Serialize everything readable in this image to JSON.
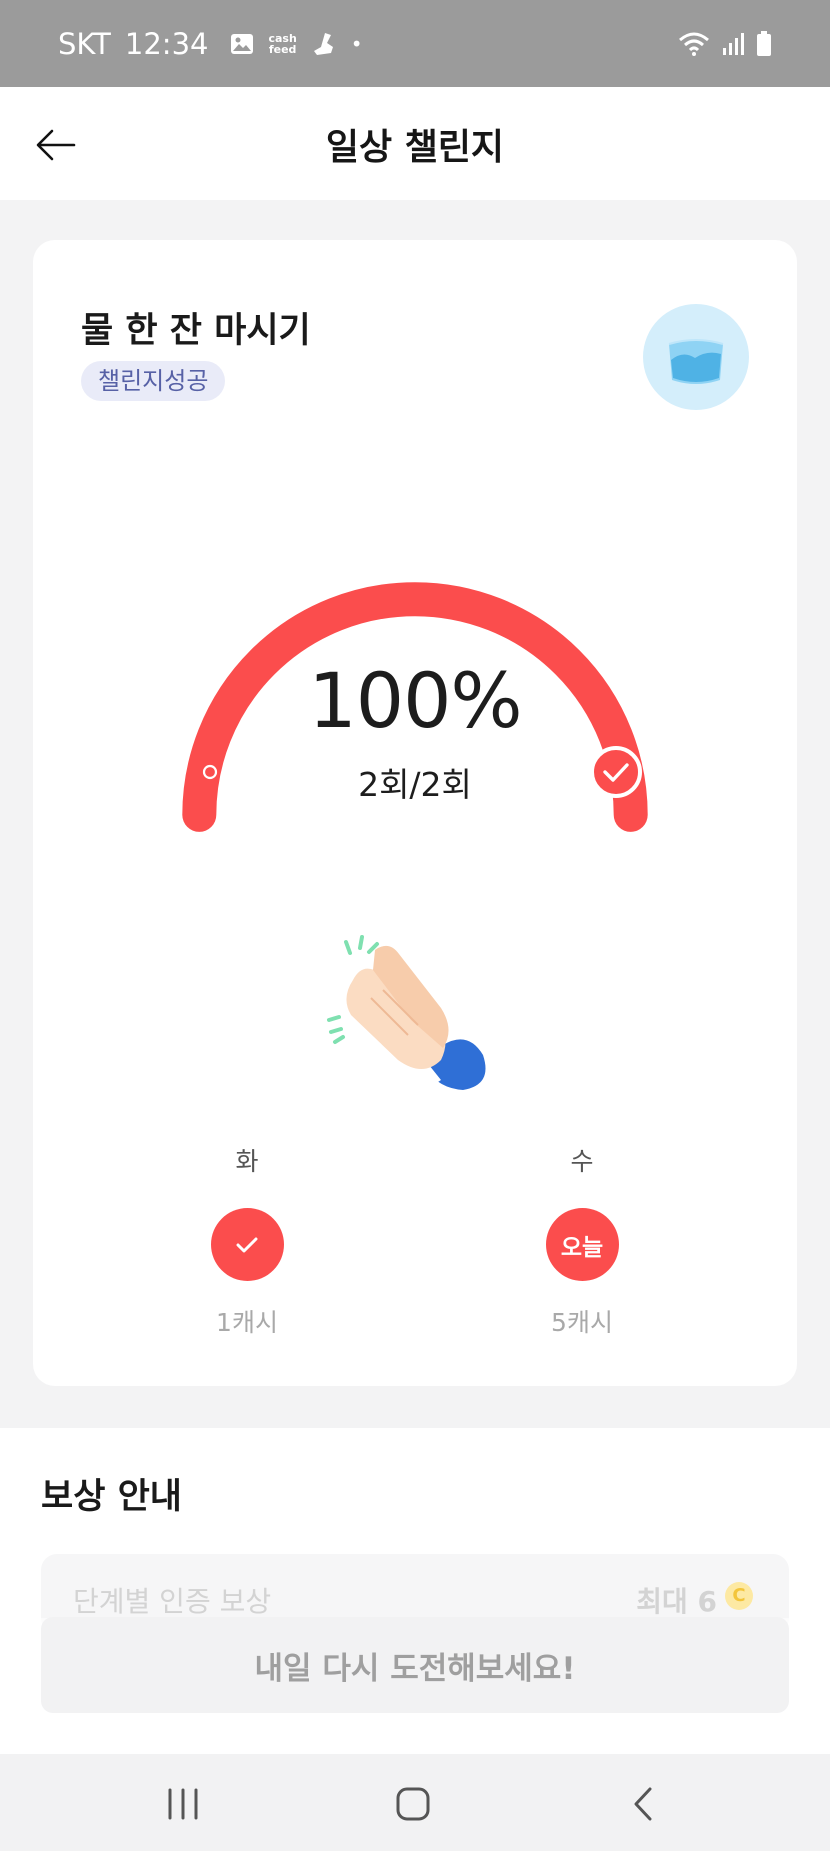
{
  "status_bar": {
    "carrier": "SKT",
    "time": "12:34",
    "cashfeed_line1": "cash",
    "cashfeed_line2": "feed",
    "dot": "•"
  },
  "header": {
    "title": "일상 챌린지"
  },
  "challenge": {
    "title": "물 한 잔 마시기",
    "badge": "챌린지성공",
    "percent": "100%",
    "progress_fraction": 1.0,
    "count": "2회/2회"
  },
  "days": [
    {
      "label": "화",
      "mark": "",
      "reward": "1캐시",
      "status": "done"
    },
    {
      "label": "수",
      "mark": "오늘",
      "reward": "5캐시",
      "status": "today"
    }
  ],
  "rewards": {
    "title": "보상 안내",
    "row_label": "단계별 인증 보상",
    "row_value": "최대 6",
    "coin_symbol": "C"
  },
  "cta": {
    "label": "내일 다시 도전해보세요!"
  },
  "colors": {
    "accent": "#fb4d4d",
    "badge_bg": "#e9ebf8",
    "badge_text": "#5761a6"
  }
}
